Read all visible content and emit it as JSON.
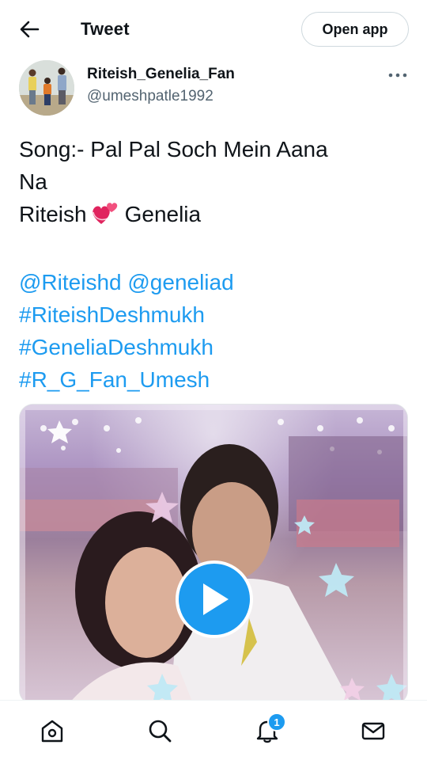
{
  "header": {
    "back_icon": "arrow-left-icon",
    "title": "Tweet",
    "open_app_label": "Open app"
  },
  "author": {
    "display_name": "Riteish_Genelia_Fan",
    "handle": "@umeshpatle1992",
    "more_icon": "more-horizontal-icon"
  },
  "tweet": {
    "line1": "Song:- Pal Pal Soch Mein Aana",
    "line2": "Na",
    "line3_before": "Riteish",
    "line3_emoji": "revolving-hearts-icon",
    "line3_after": "Genelia",
    "mention1": "@Riteishd",
    "mention2": "@geneliad",
    "hashtag1": "#RiteishDeshmukh",
    "hashtag2": "#GeneliaDeshmukh",
    "hashtag3": "#R_G_Fan_Umesh"
  },
  "media": {
    "type": "video",
    "play_icon": "play-icon"
  },
  "bottom_nav": {
    "items": [
      {
        "name": "home",
        "icon": "home-icon"
      },
      {
        "name": "explore",
        "icon": "search-icon"
      },
      {
        "name": "notifications",
        "icon": "bell-icon"
      },
      {
        "name": "messages",
        "icon": "mail-icon"
      }
    ],
    "notifications_badge": "1"
  },
  "colors": {
    "accent": "#1d9bf0",
    "text": "#0f1419",
    "secondary_text": "#536471",
    "border": "#cfd9de"
  }
}
